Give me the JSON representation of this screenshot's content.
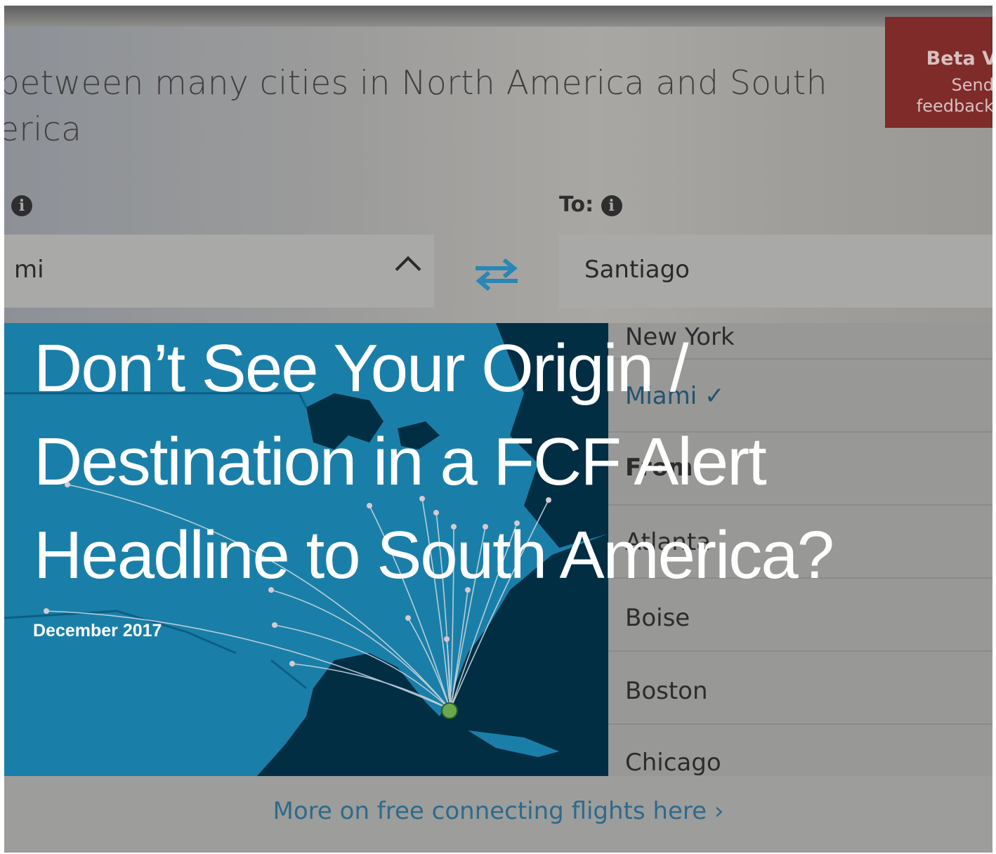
{
  "intro": {
    "line1": "between many cities in North America and South",
    "line2": "erica"
  },
  "beta": {
    "title": "Beta V",
    "line1": "Send",
    "line2": "feedback"
  },
  "form": {
    "from_label_info": "i",
    "to_label": "To:",
    "to_info": "i",
    "from_value": "mi",
    "to_value": "Santiago"
  },
  "dropdown": {
    "items": [
      {
        "label": "New York"
      },
      {
        "label": "Miami ✓"
      },
      {
        "label": "From:"
      },
      {
        "label": "Atlanta"
      },
      {
        "label": "Boise"
      },
      {
        "label": "Boston"
      },
      {
        "label": "Chicago"
      }
    ]
  },
  "footer": {
    "link": "More on free connecting flights here ›"
  },
  "headline": {
    "title_line1": "Don’t See Your Origin /",
    "title_line2": "Destination in a FCF Alert",
    "title_line3": "Headline to South America?",
    "date": "December 2017"
  },
  "colors": {
    "map_ocean": "#022e44",
    "map_land": "#1a7fa8",
    "beta_red": "#7e2b2a",
    "link_blue": "#2f6a8a",
    "hub_green": "#6aa84f"
  }
}
